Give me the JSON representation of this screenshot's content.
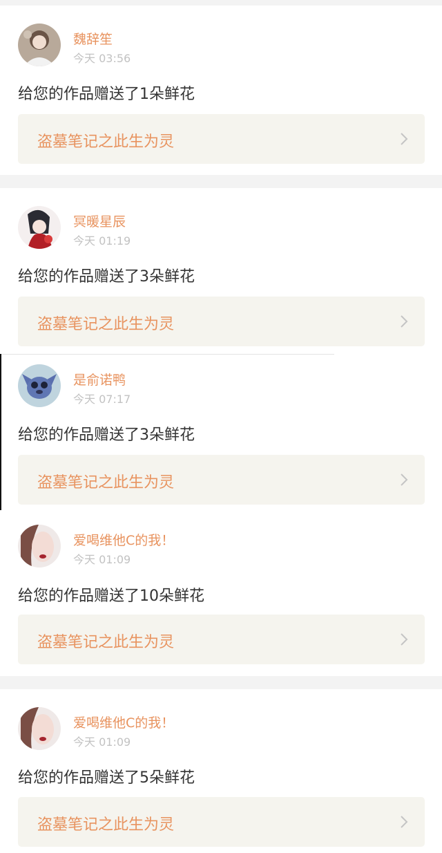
{
  "notifications": [
    {
      "user": "魏辞笙",
      "time": "今天 03:56",
      "message": "给您的作品赠送了1朵鲜花",
      "work_title": "盗墓笔记之此生为灵",
      "avatar_icon": "girl-portrait-avatar-icon"
    },
    {
      "user": "冥暖星辰",
      "time": "今天 01:19",
      "message": "给您的作品赠送了3朵鲜花",
      "work_title": "盗墓笔记之此生为灵",
      "avatar_icon": "anime-character-avatar-icon"
    },
    {
      "user": "是俞诺鸭",
      "time": "今天 07:17",
      "message": "给您的作品赠送了3朵鲜花",
      "work_title": "盗墓笔记之此生为灵",
      "avatar_icon": "stitch-cartoon-avatar-icon"
    },
    {
      "user": "爱喝维他C的我！",
      "time": "今天 01:09",
      "message": "给您的作品赠送了10朵鲜花",
      "work_title": "盗墓笔记之此生为灵",
      "avatar_icon": "woman-face-avatar-icon"
    },
    {
      "user": "爱喝维他C的我！",
      "time": "今天 01:09",
      "message": "给您的作品赠送了5朵鲜花",
      "work_title": "盗墓笔记之此生为灵",
      "avatar_icon": "woman-face-avatar-icon"
    }
  ],
  "colors": {
    "accent": "#e8935f",
    "page_background": "#f3f3f3",
    "card_background": "#ffffff",
    "link_box_background": "#f5f4ee",
    "text_primary": "#333333",
    "text_secondary": "#c2c2c2"
  }
}
